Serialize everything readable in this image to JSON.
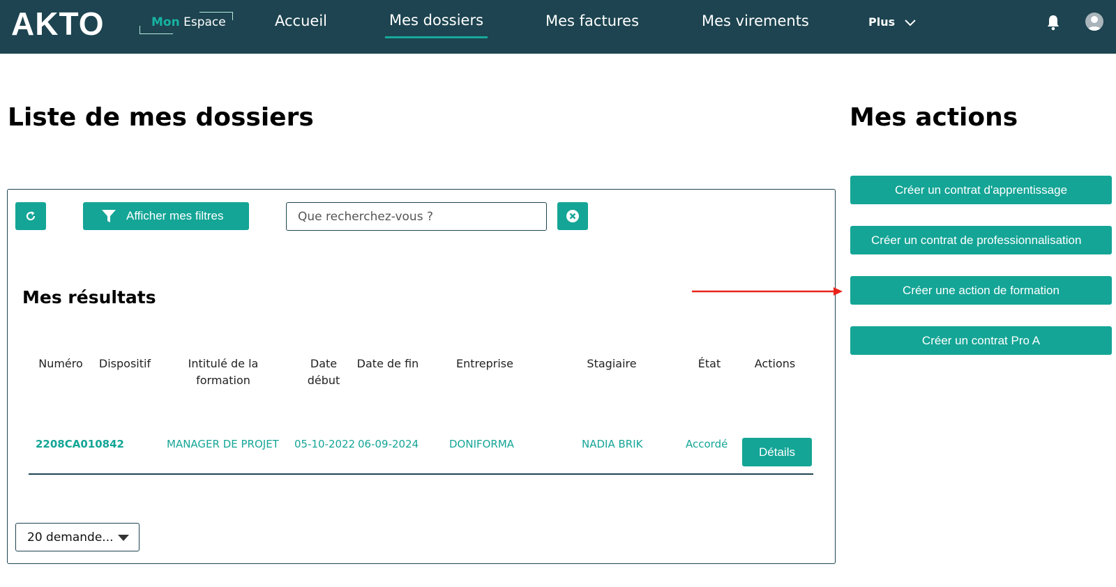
{
  "header": {
    "logo": "AKTO",
    "space_label_mon": "Mon",
    "space_label_espace": "Espace",
    "nav": [
      {
        "label": "Accueil",
        "active": false
      },
      {
        "label": "Mes dossiers",
        "active": true
      },
      {
        "label": "Mes factures",
        "active": false
      },
      {
        "label": "Mes virements",
        "active": false
      }
    ],
    "more_label": "Plus"
  },
  "main": {
    "title": "Liste de mes dossiers",
    "filter_button": "Afficher mes filtres",
    "search_placeholder": "Que recherchez-vous ?",
    "results_title": "Mes résultats",
    "columns": [
      "Numéro",
      "Dispositif",
      "Intitulé de la formation",
      "Date début",
      "Date de fin",
      "Entreprise",
      "Stagiaire",
      "État",
      "Actions"
    ],
    "rows": [
      {
        "numero": "2208CA010842",
        "dispositif": "",
        "intitule": "MANAGER DE PROJET",
        "date_debut": "05-10-2022",
        "date_fin": "06-09-2024",
        "entreprise": "DONIFORMA",
        "stagiaire": "NADIA BRIK",
        "etat": "Accordé",
        "action_label": "Détails"
      }
    ],
    "page_size": "20 demande..."
  },
  "sidebar": {
    "title": "Mes actions",
    "actions": [
      "Créer un contrat d'apprentissage",
      "Créer un contrat de professionnalisation",
      "Créer une action de formation",
      "Créer un contrat Pro A"
    ]
  },
  "colors": {
    "header_bg": "#1d4450",
    "accent": "#14a596",
    "annotation_arrow": "#e8241c"
  }
}
